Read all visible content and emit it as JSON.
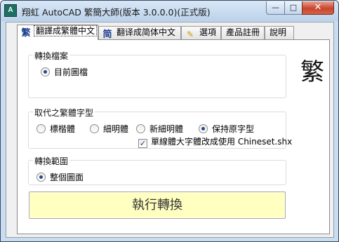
{
  "window": {
    "title": "翔虹 AutoCAD 繁簡大師(版本 3.0.0.0)(正式版)",
    "icon_text": "A",
    "controls": {
      "minimize": "—",
      "maximize": "□",
      "close": "✕"
    }
  },
  "tabs": [
    {
      "label": "翻譯成繁體中文",
      "icon": "繁",
      "active": true
    },
    {
      "label": "翻译成简体中文",
      "icon": "简",
      "active": false
    },
    {
      "label": "選項",
      "icon": "✎",
      "active": false
    },
    {
      "label": "產品註冊",
      "icon": "",
      "active": false
    },
    {
      "label": "說明",
      "icon": "",
      "active": false
    }
  ],
  "big_char": "繁",
  "groups": {
    "convert_file": {
      "label": "轉換檔案",
      "options": [
        {
          "label": "目前圖檔",
          "checked": true
        }
      ]
    },
    "replace_font": {
      "label": "取代之繁體字型",
      "options": [
        {
          "label": "標楷體",
          "checked": false
        },
        {
          "label": "細明體",
          "checked": false
        },
        {
          "label": "新細明體",
          "checked": false
        },
        {
          "label": "保持原字型",
          "checked": true
        }
      ],
      "checkbox": {
        "label": "單線體大字體改成使用 Chineset.shx",
        "checked": true
      }
    },
    "convert_range": {
      "label": "轉換範圍",
      "options": [
        {
          "label": "整個圖面",
          "checked": true
        }
      ]
    }
  },
  "execute_button": "執行轉換",
  "colors": {
    "window_frame": "#c9dcf0",
    "close_button": "#c9452c",
    "execute_button_bg": "#ffffc0",
    "radio_dot": "#1f4d8d",
    "tab_icon_traditional": "#1d3f8f",
    "tab_icon_simplified": "#1d3f8f",
    "tab_icon_options": "#c8a200"
  }
}
